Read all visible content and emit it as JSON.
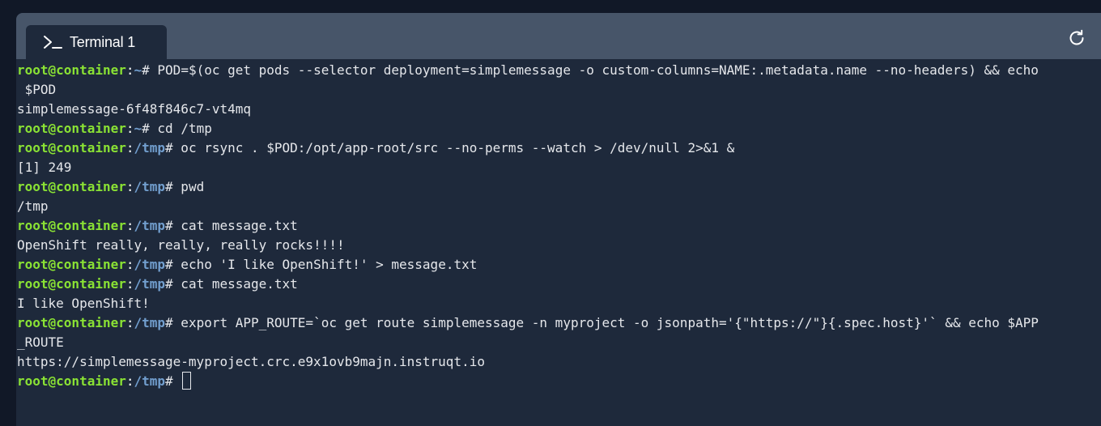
{
  "tab": {
    "icon": "terminal-prompt-icon",
    "label": "Terminal 1"
  },
  "toolbar": {
    "refresh_icon": "refresh-icon"
  },
  "colors": {
    "user": "#8ae234",
    "path": "#729fcf",
    "text": "#e5e7eb",
    "background": "#1e293b",
    "tabbar": "#475569"
  },
  "terminal": {
    "lines": [
      {
        "user": "root@container",
        "path": "~",
        "sym": "#",
        "cmd": " POD=$(oc get pods --selector deployment=simplemessage -o custom-columns=NAME:.metadata.name --no-headers) && echo"
      },
      {
        "out": " $POD"
      },
      {
        "out": "simplemessage-6f48f846c7-vt4mq"
      },
      {
        "user": "root@container",
        "path": "~",
        "sym": "#",
        "cmd": " cd /tmp"
      },
      {
        "user": "root@container",
        "path": "/tmp",
        "sym": "#",
        "cmd": " oc rsync . $POD:/opt/app-root/src --no-perms --watch > /dev/null 2>&1 &"
      },
      {
        "out": "[1] 249"
      },
      {
        "user": "root@container",
        "path": "/tmp",
        "sym": "#",
        "cmd": " pwd"
      },
      {
        "out": "/tmp"
      },
      {
        "user": "root@container",
        "path": "/tmp",
        "sym": "#",
        "cmd": " cat message.txt"
      },
      {
        "out": "OpenShift really, really, really rocks!!!!"
      },
      {
        "user": "root@container",
        "path": "/tmp",
        "sym": "#",
        "cmd": " echo 'I like OpenShift!' > message.txt"
      },
      {
        "user": "root@container",
        "path": "/tmp",
        "sym": "#",
        "cmd": " cat message.txt"
      },
      {
        "out": "I like OpenShift!"
      },
      {
        "user": "root@container",
        "path": "/tmp",
        "sym": "#",
        "cmd": " export APP_ROUTE=`oc get route simplemessage -n myproject -o jsonpath='{\"https://\"}{.spec.host}'` && echo $APP"
      },
      {
        "out": "_ROUTE"
      },
      {
        "out": "https://simplemessage-myproject.crc.e9x1ovb9majn.instruqt.io"
      },
      {
        "user": "root@container",
        "path": "/tmp",
        "sym": "#",
        "cmd": " ",
        "cursor": true
      }
    ]
  }
}
